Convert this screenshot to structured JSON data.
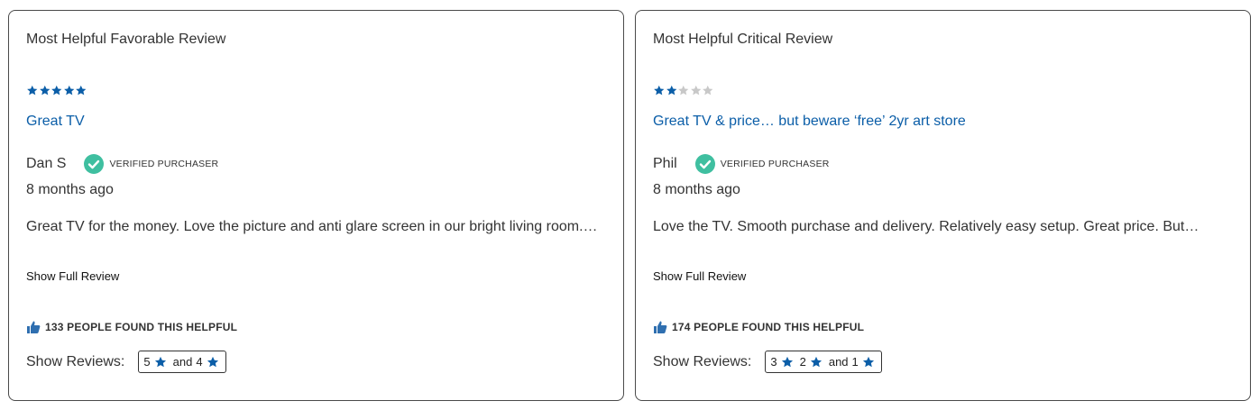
{
  "colors": {
    "star_filled": "#0b5ea8",
    "star_empty": "#c8c8c8",
    "link": "#0b5ea8",
    "verified_check": "#3fbfa0",
    "thumb": "#2f6fb0"
  },
  "favorable": {
    "heading": "Most Helpful Favorable Review",
    "rating": 5,
    "max_rating": 5,
    "title": "Great TV",
    "author": "Dan S",
    "verified_label": "VERIFIED PURCHASER",
    "date": "8 months ago",
    "snippet": "Great TV for the money. Love the picture and anti glare screen in our bright living room.…",
    "show_full_label": "Show Full Review",
    "helpful_text": "133 PEOPLE FOUND THIS HELPFUL",
    "show_reviews_label": "Show Reviews:",
    "filter": {
      "first": "5",
      "and": "and",
      "second": "4"
    }
  },
  "critical": {
    "heading": "Most Helpful Critical Review",
    "rating": 2,
    "max_rating": 5,
    "title": "Great TV & price… but beware ‘free’ 2yr art store",
    "author": "Phil",
    "verified_label": "VERIFIED PURCHASER",
    "date": "8 months ago",
    "snippet": "Love the TV. Smooth purchase and delivery. Relatively easy setup. Great price. But…",
    "show_full_label": "Show Full Review",
    "helpful_text": "174 PEOPLE FOUND THIS HELPFUL",
    "show_reviews_label": "Show Reviews:",
    "filter": {
      "first": "3",
      "middle": "2",
      "and": "and",
      "second": "1"
    }
  }
}
